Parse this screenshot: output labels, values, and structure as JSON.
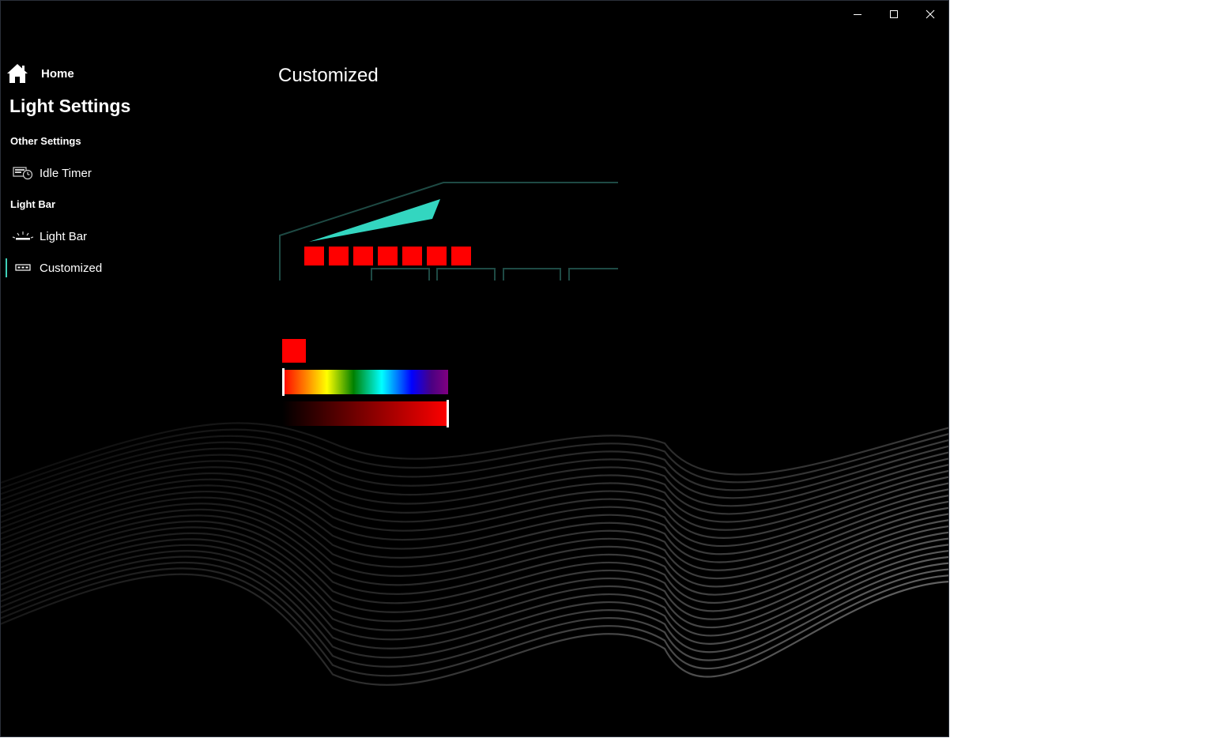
{
  "window": {
    "caption": {
      "minimize_icon": "minimize-icon",
      "maximize_icon": "maximize-icon",
      "close_icon": "close-icon"
    }
  },
  "sidebar": {
    "home_label": "Home",
    "home_icon": "home-icon",
    "app_title": "Light Settings",
    "groups": [
      {
        "header": "Other Settings",
        "items": [
          {
            "label": "Idle Timer",
            "icon": "idle-timer-icon",
            "selected": false
          }
        ]
      },
      {
        "header": "Light Bar",
        "items": [
          {
            "label": "Light Bar",
            "icon": "light-bar-icon",
            "selected": false
          },
          {
            "label": "Customized",
            "icon": "customized-icon",
            "selected": true
          }
        ]
      }
    ]
  },
  "main": {
    "page_title": "Customized",
    "device": {
      "outline_color": "#1e4a44",
      "light_strip_color": "#33d6c0",
      "led_count": 7,
      "led_color": "#ff0000"
    },
    "color_picker": {
      "selected_color": "#ff0000",
      "hue": 0,
      "brightness_percent": 100
    }
  },
  "theme": {
    "background": "#000000",
    "accent": "#3fd0b8",
    "text": "#ffffff"
  }
}
